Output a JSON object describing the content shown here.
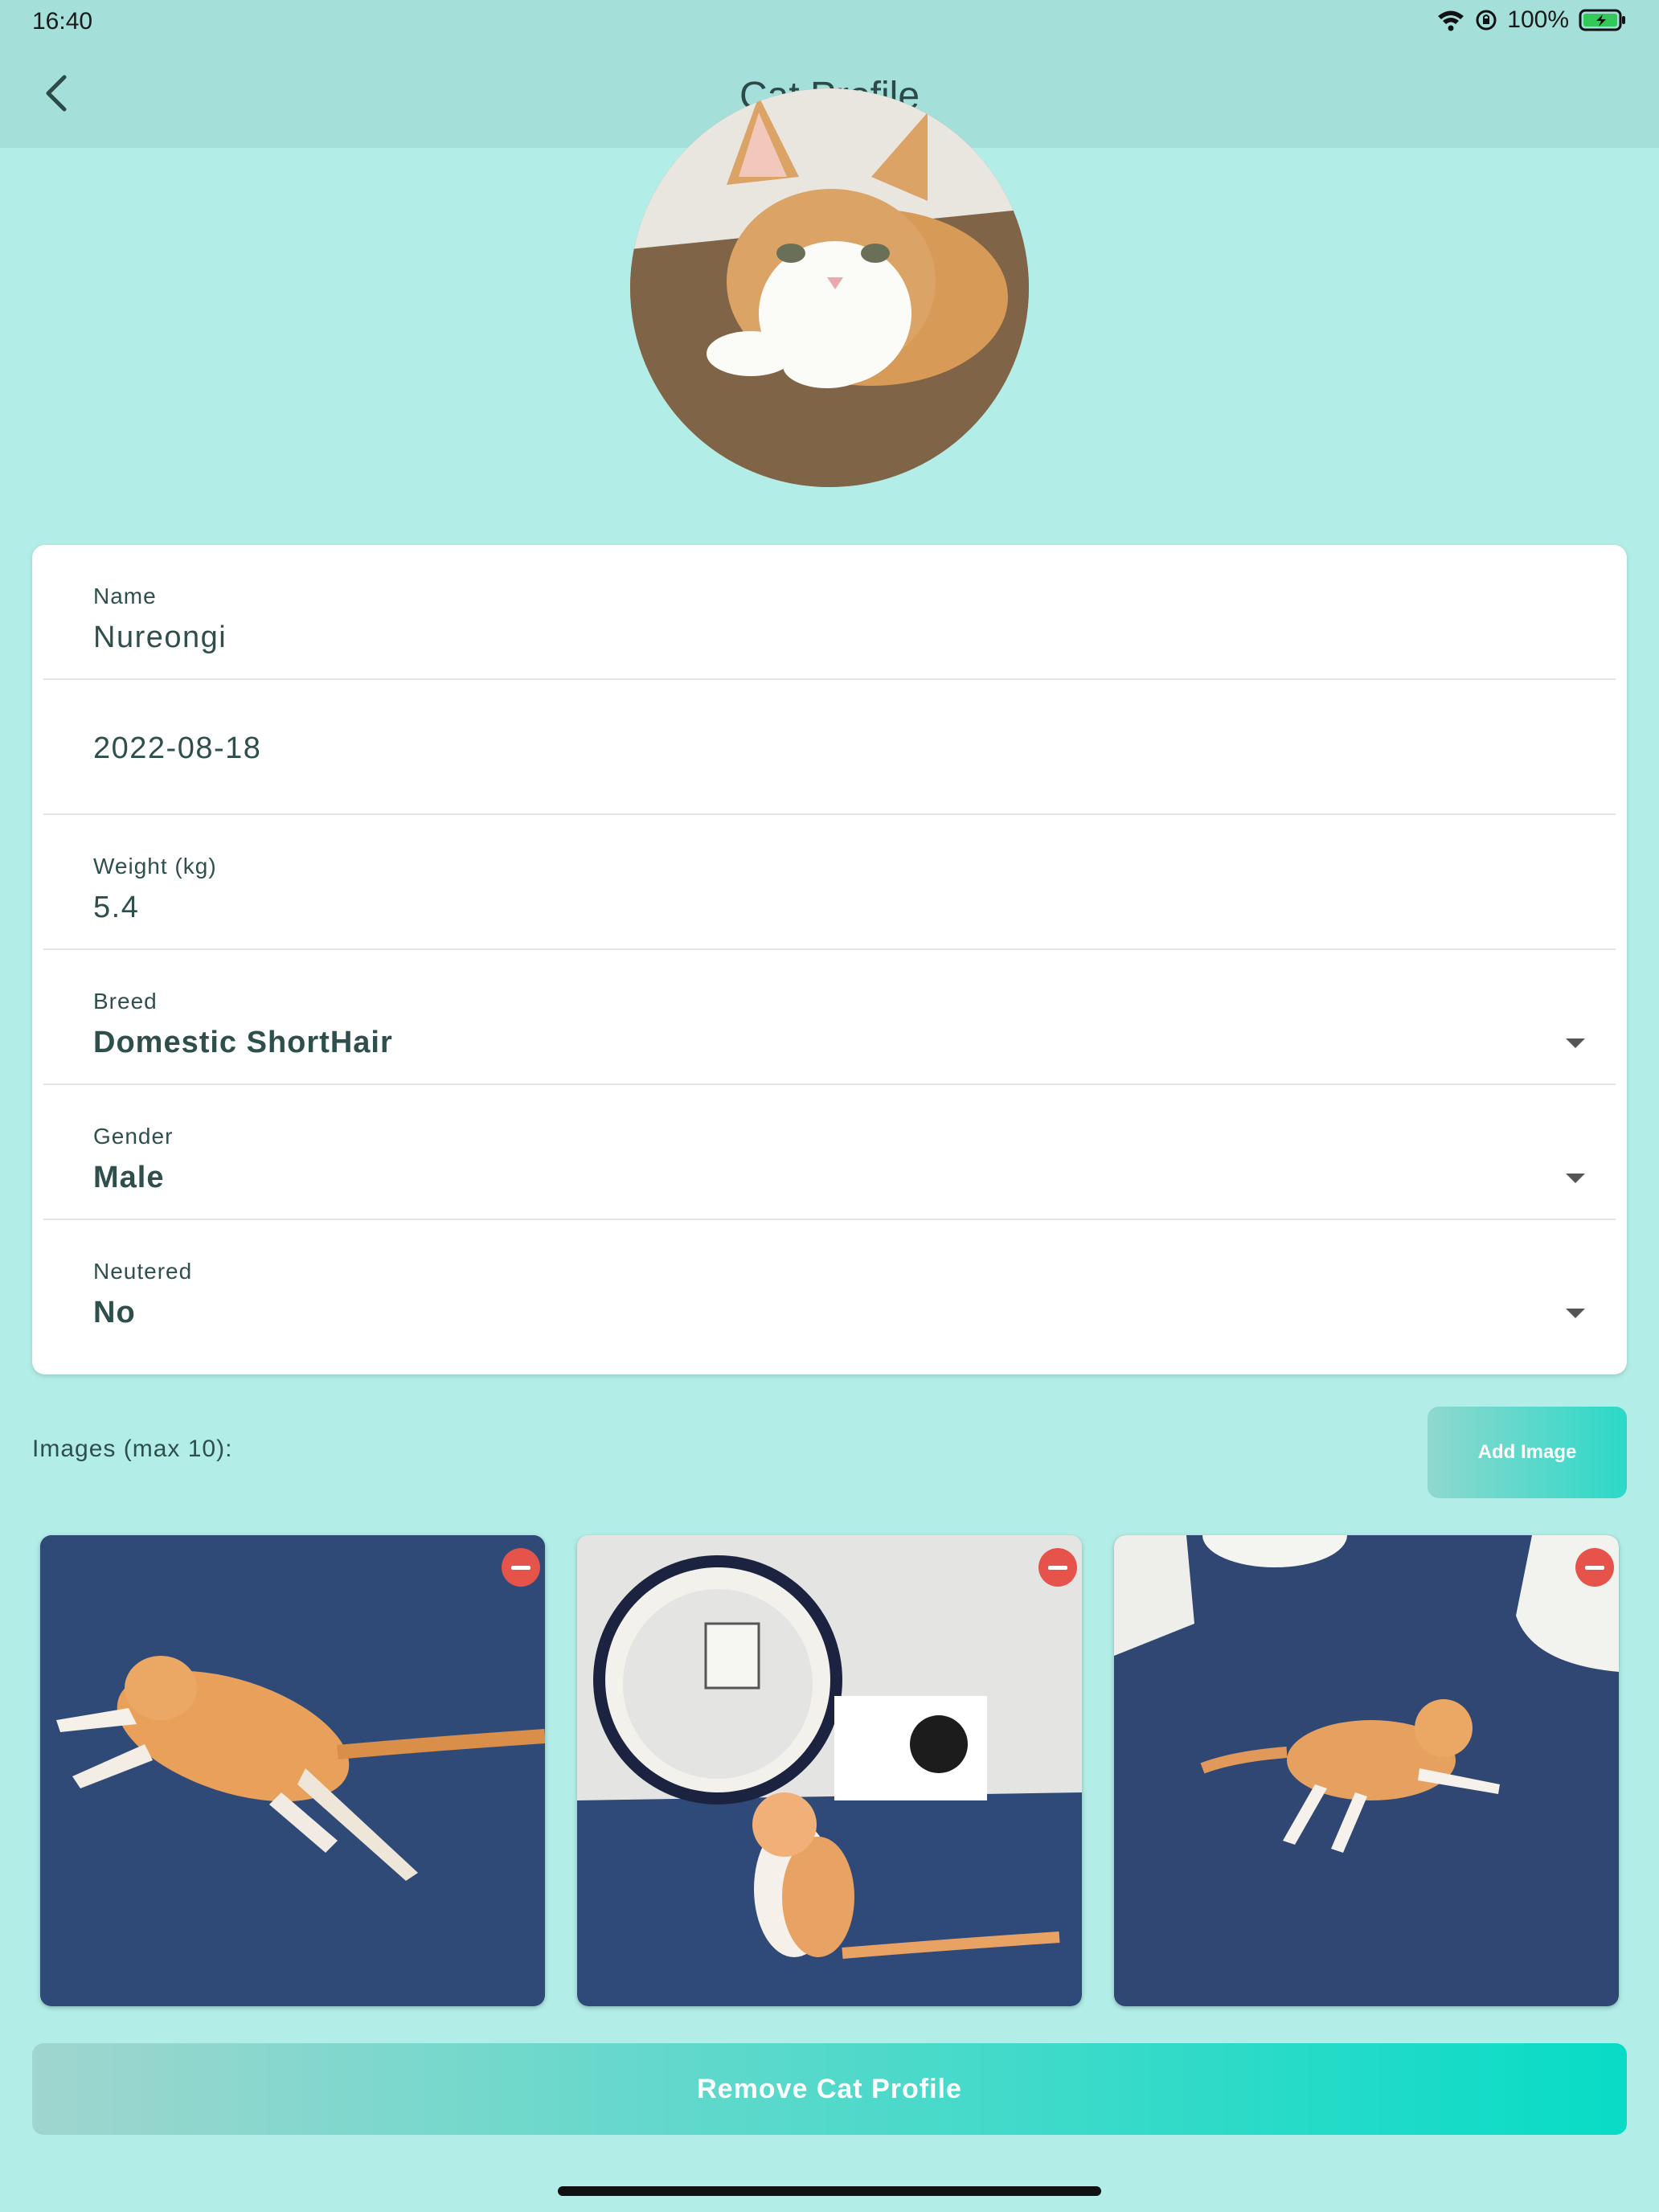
{
  "status_bar": {
    "time": "16:40",
    "battery": "100%"
  },
  "header": {
    "title": "Cat Profile",
    "back_icon": "chevron-left-icon"
  },
  "avatar": {
    "icon": "cat-photo"
  },
  "form": {
    "name": {
      "label": "Name",
      "value": "Nureongi"
    },
    "birthdate": {
      "value": "2022-08-18"
    },
    "weight": {
      "label": "Weight (kg)",
      "value": "5.4"
    },
    "breed": {
      "label": "Breed",
      "value": "Domestic ShortHair"
    },
    "gender": {
      "label": "Gender",
      "value": "Male"
    },
    "neutered": {
      "label": "Neutered",
      "value": "No"
    }
  },
  "images": {
    "label": "Images (max 10):",
    "add_button": "Add Image",
    "count": 3
  },
  "remove_button": "Remove Cat Profile",
  "colors": {
    "background": "#b2eee7",
    "header": "#a4dfd9",
    "accent_start": "#9fd6cf",
    "accent_end": "#07dcc6",
    "remove_icon": "#e5534b"
  }
}
